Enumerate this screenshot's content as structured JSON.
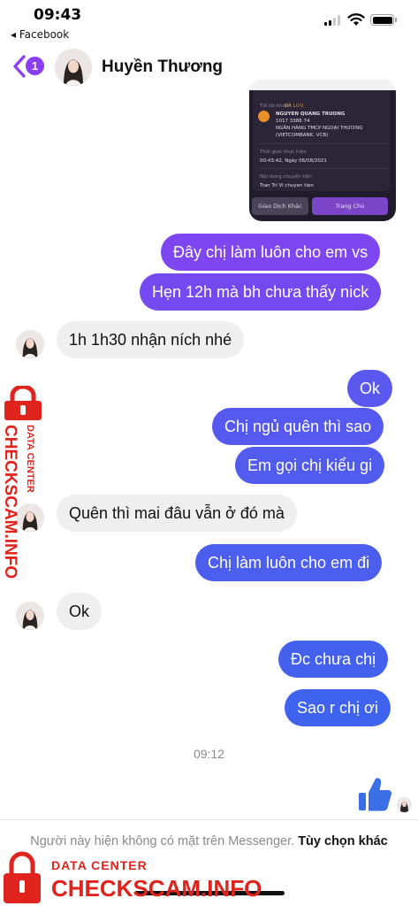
{
  "status_bar": {
    "time": "09:43",
    "back_app": "◂ Facebook"
  },
  "header": {
    "unread_count": "1",
    "contact_name": "Huyền Thương"
  },
  "screenshot": {
    "recipient_label": "Tới tài khoản",
    "saved_tag": "ĐÃ LƯU",
    "recipient_name": "NGUYEN QUANG TRUONG",
    "account_no": "1017 3386 74",
    "bank_line1": "NGÂN HÀNG TMCP NGOẠI THƯƠNG",
    "bank_line2": "(VIETCOMBANK, VCB)",
    "time_label": "Thời gian thực hiện",
    "time_value": "00:43:42, Ngày 06/08/2021",
    "content_label": "Nội dung chuyển tiền",
    "content_value": "Tran Tri Vi chuyen tien",
    "other_button": "Giao Dịch Khác",
    "home_button": "Trang Chủ"
  },
  "messages": [
    {
      "text": "Đây chị làm luôn cho em vs",
      "direction": "out"
    },
    {
      "text": "Hẹn 12h mà bh chưa thấy nick",
      "direction": "out"
    },
    {
      "text": "1h 1h30 nhận ních nhé",
      "direction": "in"
    },
    {
      "text": "Ok",
      "direction": "out"
    },
    {
      "text": "Chị ngủ quên thì sao",
      "direction": "out"
    },
    {
      "text": "Em gọi chị kiểu gi",
      "direction": "out"
    },
    {
      "text": "Quên thì mai đâu vẫn ở đó mà",
      "direction": "in"
    },
    {
      "text": "Chị làm luôn cho em đi",
      "direction": "out"
    },
    {
      "text": "Ok",
      "direction": "in"
    },
    {
      "text": "Đc chưa chị",
      "direction": "out"
    },
    {
      "text": "Sao r chị ơi",
      "direction": "out"
    }
  ],
  "timestamp": "09:12",
  "notice": {
    "text": "Người này hiện không có mặt trên Messenger.",
    "action": "Tùy chọn khác"
  },
  "watermark": {
    "line1": "DATA CENTER",
    "line2": "CHECKSCAM.INFO"
  },
  "colors": {
    "accent": "#8b3cf6",
    "bubble_out_top": "#8a3ef0",
    "bubble_out_bottom": "#3f63ee",
    "bubble_in": "#efefef",
    "like_icon": "#3a6fe8",
    "watermark_red": "#e0231c"
  },
  "icons": [
    "signal-icon",
    "wifi-icon",
    "battery-icon",
    "back-chevron-icon",
    "like-icon",
    "lock-icon"
  ]
}
